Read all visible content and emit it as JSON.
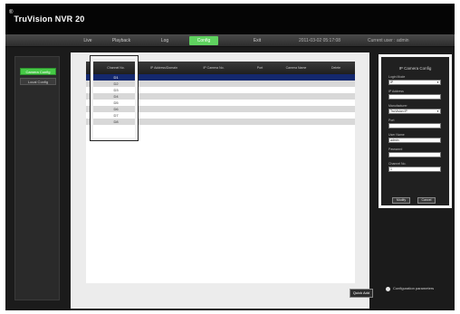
{
  "app": {
    "logo_mark": "®",
    "title": "TruVision NVR 20"
  },
  "nav": {
    "items": [
      "Live",
      "Playback",
      "Log",
      "Config",
      "Exit"
    ],
    "active": "Config",
    "datetime": "2011-03-02 05:17:08",
    "user": "Current user : admin"
  },
  "sidebar": {
    "items": [
      "Camera Config",
      "Local Config"
    ],
    "active": "Camera Config"
  },
  "table": {
    "columns": [
      "Channel No.",
      "IP Address/Domain",
      "IP Camera No.",
      "Port",
      "Camera Name",
      "Delete"
    ],
    "rows": [
      "D1",
      "D2",
      "D3",
      "D4",
      "D5",
      "D6",
      "D7",
      "D8"
    ],
    "selected_row": "D1"
  },
  "actions": {
    "quick_add": "Quick Add"
  },
  "footer": {
    "config_label": "Configuration parameters"
  },
  "ip_camera_config": {
    "title": "IP Camera Config",
    "fields": [
      {
        "label": "Login Mode",
        "value": "IP",
        "type": "select"
      },
      {
        "label": "IP Address",
        "value": "",
        "type": "text"
      },
      {
        "label": "Manufacturer",
        "value": "TruVision IP",
        "type": "select"
      },
      {
        "label": "Port",
        "value": "",
        "type": "text"
      },
      {
        "label": "User Name",
        "value": "admin",
        "type": "text"
      },
      {
        "label": "Password",
        "value": "",
        "type": "text"
      },
      {
        "label": "Channel No.",
        "value": "1",
        "type": "text"
      }
    ],
    "modify_label": "Modify",
    "cancel_label": "Cancel"
  }
}
